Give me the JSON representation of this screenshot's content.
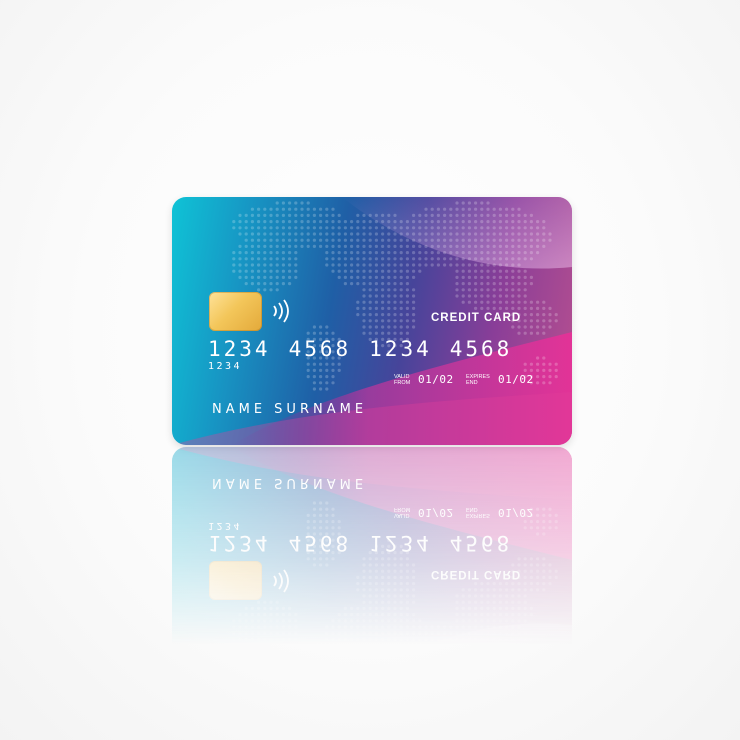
{
  "card": {
    "title": "CREDIT CARD",
    "number_groups": [
      "1234",
      "4568",
      "1234",
      "4568"
    ],
    "number_small": "1234",
    "valid_from_label_1": "VALID",
    "valid_from_label_2": "FROM",
    "valid_from_value": "01/02",
    "expires_label_1": "EXPIRES",
    "expires_label_2": "END",
    "expires_value": "01/02",
    "holder_name": "NAME SURNAME",
    "icons": [
      "chip-icon",
      "contactless-icon",
      "world-map-icon"
    ],
    "colors": {
      "gradient_start": "#0fc3d6",
      "gradient_mid": "#1f5fa6",
      "gradient_end": "#b8508f",
      "accent_magenta": "#d42e9a",
      "chip": "#f3c65a",
      "text": "#ffffff"
    }
  }
}
